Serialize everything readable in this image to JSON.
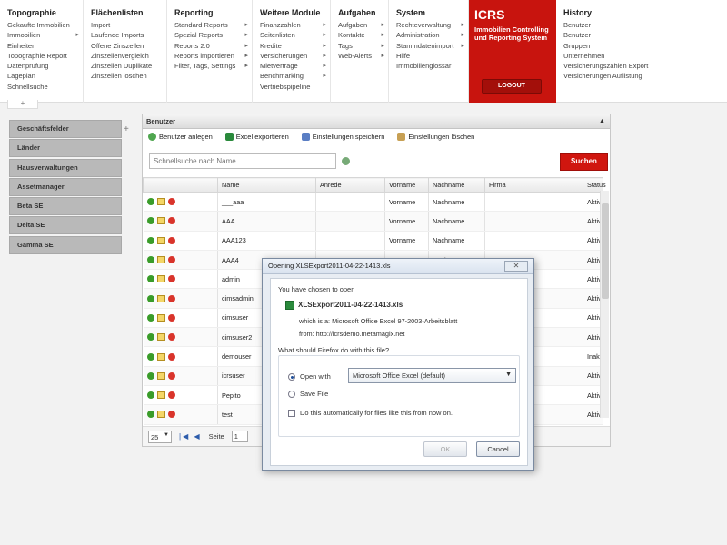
{
  "menus": [
    {
      "title": "Topographie",
      "items": [
        {
          "label": "Gekaufte Immobilien",
          "arrow": false
        },
        {
          "label": "Immobilien",
          "arrow": true
        },
        {
          "label": "Einheiten",
          "arrow": false
        },
        {
          "label": "Topographie Report",
          "arrow": false
        },
        {
          "label": "Datenprüfung",
          "arrow": false
        },
        {
          "label": "Lageplan",
          "arrow": false
        },
        {
          "label": "Schnellsuche",
          "arrow": false
        }
      ]
    },
    {
      "title": "Flächenlisten",
      "items": [
        {
          "label": "Import",
          "arrow": false
        },
        {
          "label": "Laufende Imports",
          "arrow": false
        },
        {
          "label": "Offene Zinszeilen",
          "arrow": false
        },
        {
          "label": "Zinszeilenvergleich",
          "arrow": false
        },
        {
          "label": "Zinszeilen Duplikate",
          "arrow": false
        },
        {
          "label": "Zinszeilen löschen",
          "arrow": false
        }
      ]
    },
    {
      "title": "Reporting",
      "items": [
        {
          "label": "Standard Reports",
          "arrow": true
        },
        {
          "label": "Spezial Reports",
          "arrow": true
        },
        {
          "label": "Reports 2.0",
          "arrow": true
        },
        {
          "label": "Reports importieren",
          "arrow": true
        },
        {
          "label": "Filter, Tags, Settings",
          "arrow": true
        }
      ]
    },
    {
      "title": "Weitere Module",
      "items": [
        {
          "label": "Finanzzahlen",
          "arrow": true
        },
        {
          "label": "Seitenlisten",
          "arrow": true
        },
        {
          "label": "Kredite",
          "arrow": true
        },
        {
          "label": "Versicherungen",
          "arrow": true
        },
        {
          "label": "Mietverträge",
          "arrow": true
        },
        {
          "label": "Benchmarking",
          "arrow": true
        },
        {
          "label": "Vertriebspipeline",
          "arrow": false
        }
      ]
    },
    {
      "title": "Aufgaben",
      "items": [
        {
          "label": "Aufgaben",
          "arrow": true
        },
        {
          "label": "Kontakte",
          "arrow": true
        },
        {
          "label": "Tags",
          "arrow": true
        },
        {
          "label": "Web-Alerts",
          "arrow": true
        }
      ]
    },
    {
      "title": "System",
      "items": [
        {
          "label": "Rechteverwaltung",
          "arrow": true
        },
        {
          "label": "Administration",
          "arrow": true
        },
        {
          "label": "Stammdatenimport",
          "arrow": true
        },
        {
          "label": "Hilfe",
          "arrow": false
        },
        {
          "label": "Immobilienglossar",
          "arrow": false
        }
      ]
    }
  ],
  "brand": {
    "name": "ICRS",
    "subtitle": "Immobilien Controlling und Reporting System",
    "logout": "LOGOUT",
    "color": "#c8140e"
  },
  "history": {
    "title": "History",
    "items": [
      "Benutzer",
      "Benutzer",
      "Gruppen",
      "Unternehmen",
      "Versicherungszahlen Export",
      "Versicherungen Auflistung"
    ]
  },
  "sidebar": {
    "items": [
      "Geschäftsfelder",
      "Länder",
      "Hausverwaltungen",
      "Assetmanager",
      "Beta SE",
      "Delta SE",
      "Gamma SE"
    ]
  },
  "panel": {
    "title": "Benutzer",
    "toolbar": [
      "Benutzer anlegen",
      "Excel exportieren",
      "Einstellungen speichern",
      "Einstellungen löschen"
    ],
    "search_placeholder": "Schnellsuche nach Name",
    "search_button": "Suchen",
    "columns": [
      "",
      "Name",
      "Anrede",
      "Vorname",
      "Nachname",
      "Firma",
      "Status"
    ],
    "rows": [
      {
        "name": "___aaa",
        "anrede": "",
        "vorname": "Vorname",
        "nachname": "Nachname",
        "firma": "",
        "status": "Aktiv"
      },
      {
        "name": "AAA",
        "anrede": "",
        "vorname": "Vorname",
        "nachname": "Nachname",
        "firma": "",
        "status": "Aktiv"
      },
      {
        "name": "AAA123",
        "anrede": "",
        "vorname": "Vorname",
        "nachname": "Nachname",
        "firma": "",
        "status": "Aktiv"
      },
      {
        "name": "AAA4",
        "anrede": "",
        "vorname": "Vorname",
        "nachname": "Nachname",
        "firma": "",
        "status": "Aktiv"
      },
      {
        "name": "admin",
        "anrede": "",
        "vorname": "",
        "nachname": "",
        "firma": "",
        "status": "Aktiv"
      },
      {
        "name": "cimsadmin",
        "anrede": "",
        "vorname": "",
        "nachname": "",
        "firma": "",
        "status": "Aktiv"
      },
      {
        "name": "cimsuser",
        "anrede": "",
        "vorname": "",
        "nachname": "",
        "firma": "",
        "status": "Aktiv"
      },
      {
        "name": "cimsuser2",
        "anrede": "",
        "vorname": "",
        "nachname": "",
        "firma": "",
        "status": "Aktiv"
      },
      {
        "name": "demouser",
        "anrede": "",
        "vorname": "",
        "nachname": "",
        "firma": "",
        "status": "Inaktiv"
      },
      {
        "name": "icrsuser",
        "anrede": "",
        "vorname": "",
        "nachname": "",
        "firma": "",
        "status": "Aktiv"
      },
      {
        "name": "Pepito",
        "anrede": "",
        "vorname": "",
        "nachname": "",
        "firma": "",
        "status": "Aktiv"
      },
      {
        "name": "test",
        "anrede": "",
        "vorname": "",
        "nachname": "",
        "firma": "",
        "status": "Aktiv"
      }
    ],
    "pager": {
      "page_size": "25",
      "page_label": "Seite",
      "page": "1"
    }
  },
  "dialog": {
    "title": "Opening XLSExport2011-04-22-1413.xls",
    "intro": "You have chosen to open",
    "filename": "XLSExport2011-04-22-1413.xls",
    "which_is": "which is a:  Microsoft Office Excel 97-2003-Arbeitsblatt",
    "from": "from:  http://icrsdemo.metamagix.net",
    "question": "What should Firefox do with this file?",
    "open_with_label": "Open with",
    "open_with_app": "Microsoft Office Excel (default)",
    "save_label": "Save File",
    "auto_label": "Do this automatically for files like this from now on.",
    "ok": "OK",
    "cancel": "Cancel"
  }
}
